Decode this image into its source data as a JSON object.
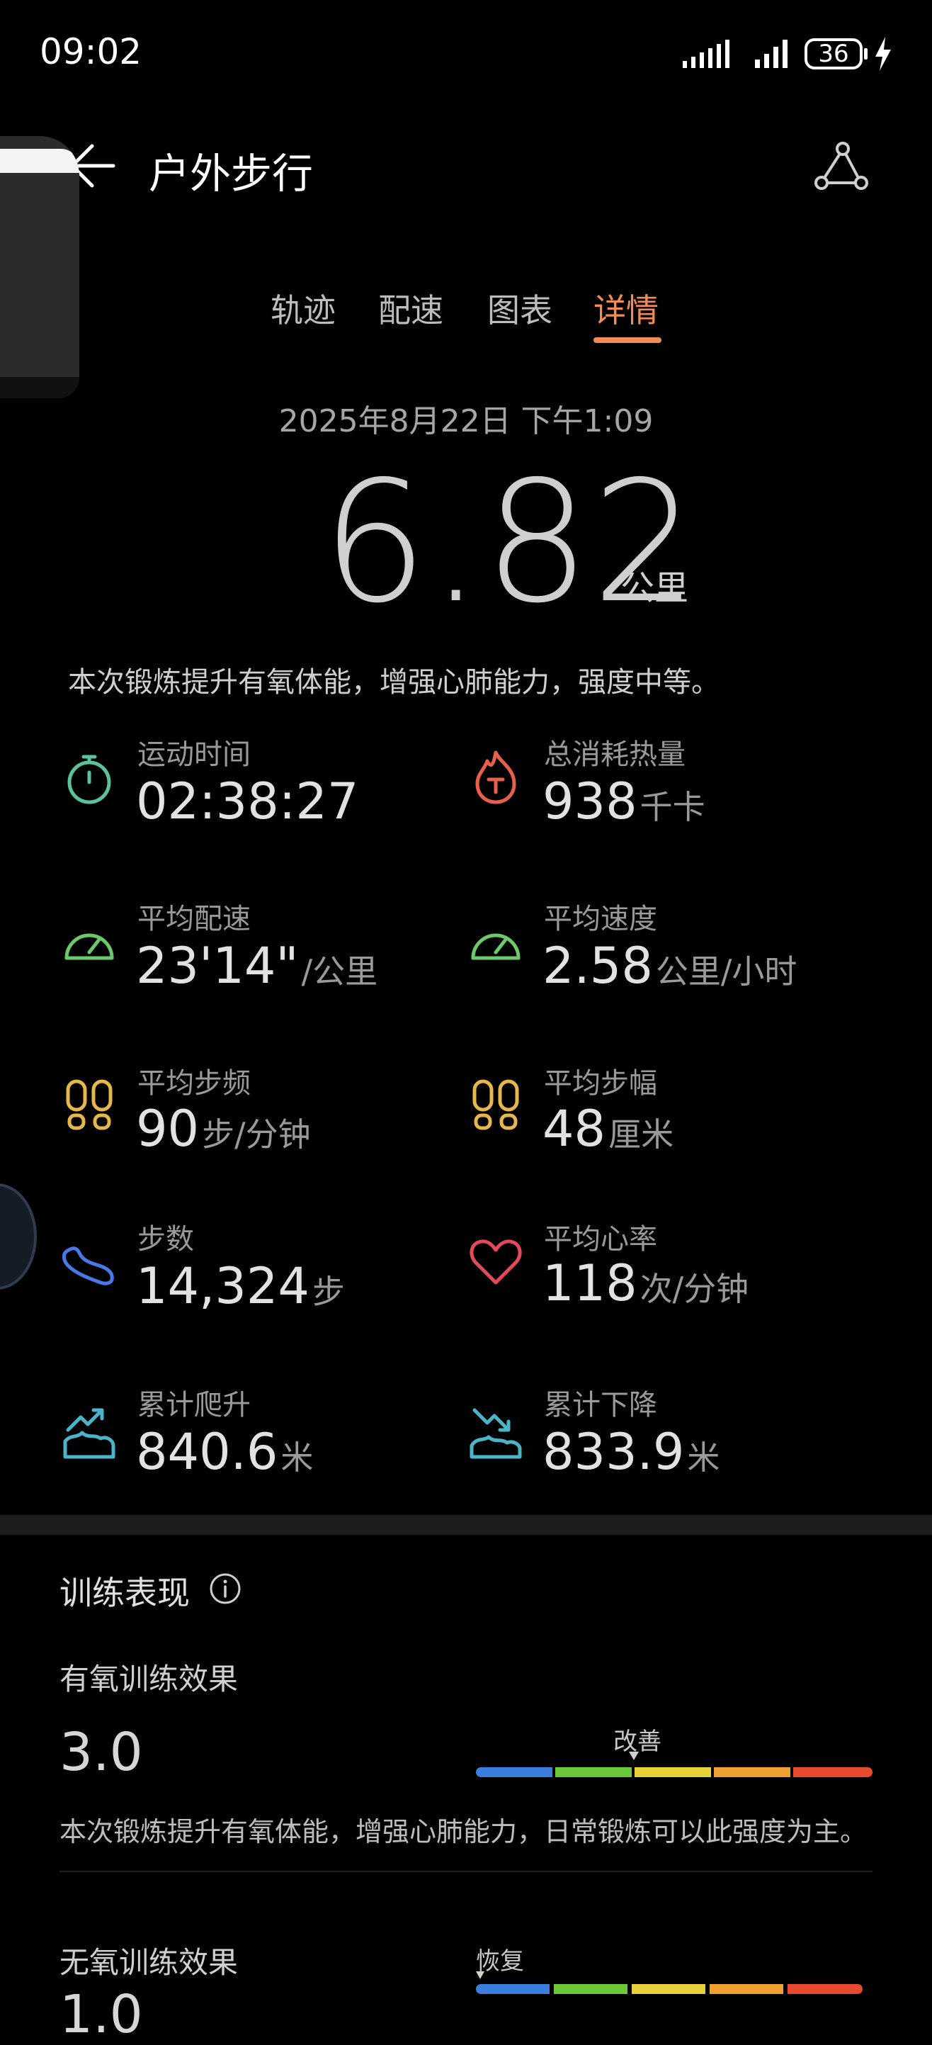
{
  "status_bar": {
    "time": "09:02",
    "battery": "36"
  },
  "header": {
    "title": "户外步行"
  },
  "tabs": [
    {
      "label": "轨迹"
    },
    {
      "label": "配速"
    },
    {
      "label": "图表"
    },
    {
      "label": "详情",
      "active": true
    }
  ],
  "summary": {
    "date": "2025年8月22日 下午1:09",
    "distance": "6.82",
    "distance_unit": "公里",
    "description": "本次锻炼提升有氧体能，增强心肺能力，强度中等。"
  },
  "metrics": [
    {
      "label": "运动时间",
      "value": "02:38:27",
      "unit": "",
      "icon": "stopwatch-icon",
      "color": "#5cc29a"
    },
    {
      "label": "总消耗热量",
      "value": "938",
      "unit": "千卡",
      "icon": "flame-icon",
      "color": "#e8604c"
    },
    {
      "label": "平均配速",
      "value": "23'14\"",
      "unit": "/公里",
      "icon": "speedometer-icon",
      "color": "#6cc86a"
    },
    {
      "label": "平均速度",
      "value": "2.58",
      "unit": "公里/小时",
      "icon": "speedometer-icon",
      "color": "#6cc86a"
    },
    {
      "label": "平均步频",
      "value": "90",
      "unit": "步/分钟",
      "icon": "footprints-icon",
      "color": "#e6b84a"
    },
    {
      "label": "平均步幅",
      "value": "48",
      "unit": "厘米",
      "icon": "footprints-icon",
      "color": "#e6b84a"
    },
    {
      "label": "步数",
      "value": "14,324",
      "unit": "步",
      "icon": "shoe-icon",
      "color": "#4a78e8"
    },
    {
      "label": "平均心率",
      "value": "118",
      "unit": "次/分钟",
      "icon": "heart-icon",
      "color": "#e24a5a"
    },
    {
      "label": "累计爬升",
      "value": "840.6",
      "unit": "米",
      "icon": "ascent-icon",
      "color": "#4ab4c8"
    },
    {
      "label": "累计下降",
      "value": "833.9",
      "unit": "米",
      "icon": "descent-icon",
      "color": "#4ab4c8"
    }
  ],
  "training": {
    "title": "训练表现",
    "aerobic": {
      "label": "有氧训练效果",
      "value": "3.0",
      "level": "改善",
      "description": "本次锻炼提升有氧体能，增强心肺能力，日常锻炼可以此强度为主。"
    },
    "anaerobic": {
      "label": "无氧训练效果",
      "value": "1.0",
      "level": "恢复"
    },
    "scale_colors": [
      "#3a7fe0",
      "#6cc83a",
      "#e8d03a",
      "#f0a030",
      "#e84a30"
    ]
  }
}
